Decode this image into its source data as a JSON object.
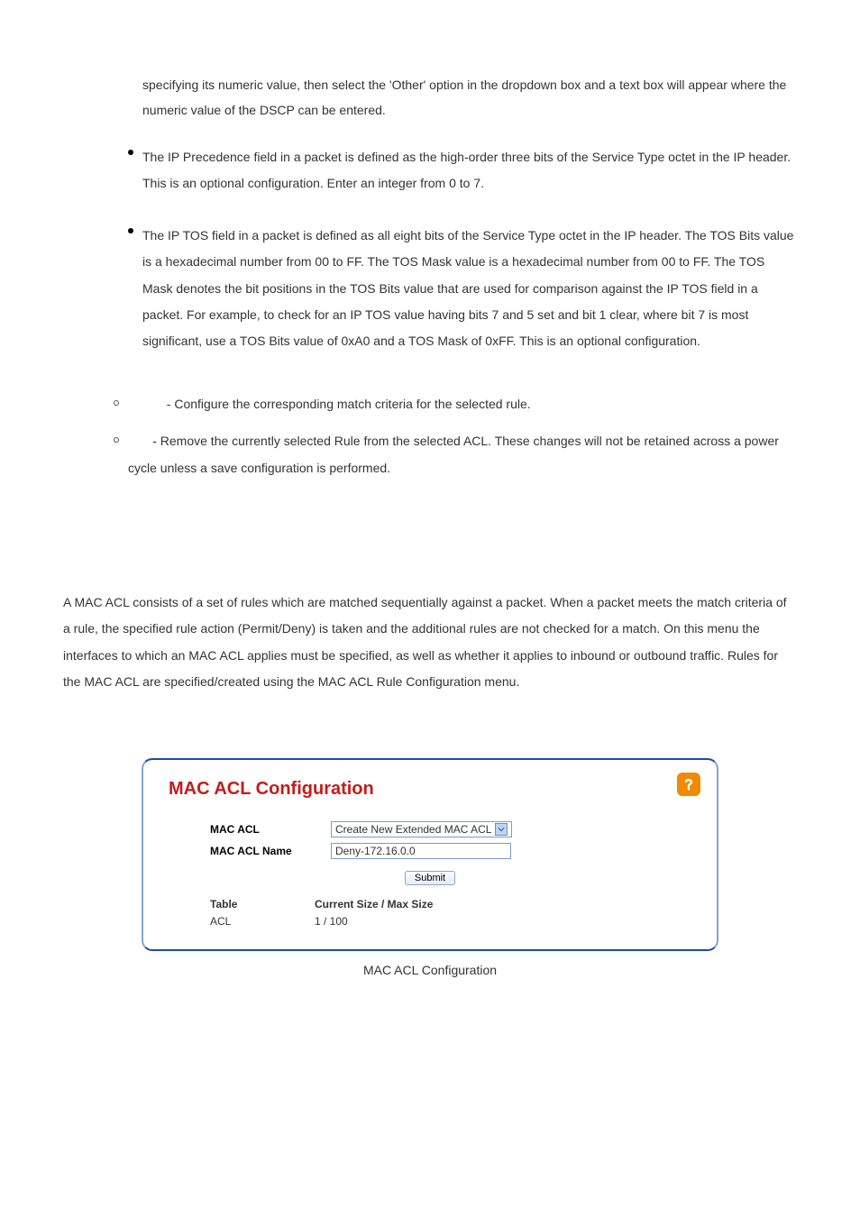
{
  "top_paragraph": "specifying its numeric value, then select the 'Other' option in the dropdown box and a text box will appear where the numeric value of the DSCP can be entered.",
  "bullets": [
    "The IP Precedence field in a packet is defined as the high-order three bits of the Service Type octet in the IP header. This is an optional configuration. Enter an integer from 0 to 7.",
    "The IP TOS field in a packet is defined as all eight bits of the Service Type octet in the IP header. The TOS Bits value is a hexadecimal number from 00 to FF. The TOS Mask value is a hexadecimal number from 00 to FF. The TOS Mask denotes the bit positions in the TOS Bits value that are used for comparison against the IP TOS field in a packet. For example, to check for an IP TOS value having bits 7 and 5 set and bit 1 clear, where bit 7 is most significant, use a TOS Bits value of 0xA0 and a TOS Mask of 0xFF. This is an optional configuration."
  ],
  "circle_items": [
    "           - Configure the corresponding match criteria for the selected rule.",
    "       - Remove the currently selected Rule from the selected ACL. These changes will not be retained across a power cycle unless a save configuration is performed."
  ],
  "section_text": "A MAC ACL consists of a set of rules which are matched sequentially against a packet. When a packet meets the match criteria of a rule, the specified rule action (Permit/Deny) is taken and the additional rules are not checked for a match. On this menu the interfaces to which an MAC ACL applies must be specified, as well as whether it applies to inbound or outbound traffic. Rules for the MAC ACL are specified/created using the MAC ACL Rule Configuration menu.",
  "panel": {
    "title": "MAC ACL Configuration",
    "label_mac_acl": "MAC ACL",
    "select_value": "Create New Extended MAC ACL",
    "label_mac_acl_name": "MAC ACL Name",
    "input_value": "Deny-172.16.0.0",
    "submit_label": "Submit",
    "table_col1_header": "Table",
    "table_col2_header": "Current Size / Max Size",
    "table_col1_value": "ACL",
    "table_col2_value": "1 / 100"
  },
  "figure_caption": "MAC ACL Configuration"
}
